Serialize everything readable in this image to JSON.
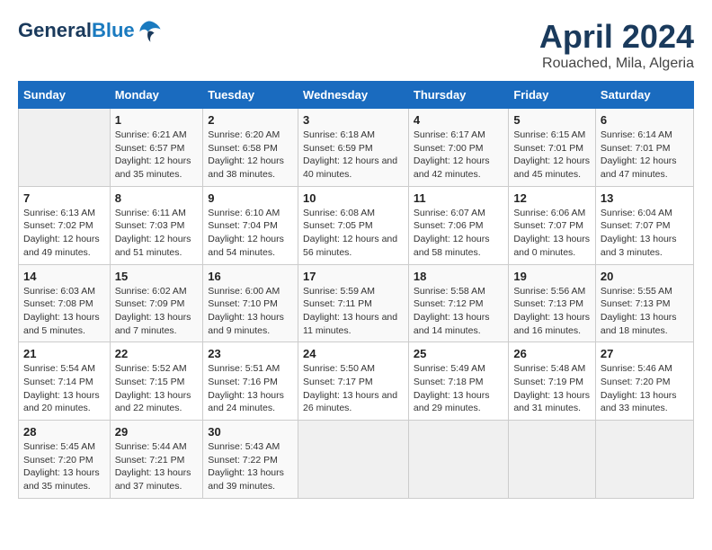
{
  "header": {
    "logo_line1": "General",
    "logo_line2": "Blue",
    "title": "April 2024",
    "subtitle": "Rouached, Mila, Algeria"
  },
  "calendar": {
    "days_of_week": [
      "Sunday",
      "Monday",
      "Tuesday",
      "Wednesday",
      "Thursday",
      "Friday",
      "Saturday"
    ],
    "weeks": [
      [
        {
          "day": "",
          "info": ""
        },
        {
          "day": "1",
          "info": "Sunrise: 6:21 AM\nSunset: 6:57 PM\nDaylight: 12 hours\nand 35 minutes."
        },
        {
          "day": "2",
          "info": "Sunrise: 6:20 AM\nSunset: 6:58 PM\nDaylight: 12 hours\nand 38 minutes."
        },
        {
          "day": "3",
          "info": "Sunrise: 6:18 AM\nSunset: 6:59 PM\nDaylight: 12 hours\nand 40 minutes."
        },
        {
          "day": "4",
          "info": "Sunrise: 6:17 AM\nSunset: 7:00 PM\nDaylight: 12 hours\nand 42 minutes."
        },
        {
          "day": "5",
          "info": "Sunrise: 6:15 AM\nSunset: 7:01 PM\nDaylight: 12 hours\nand 45 minutes."
        },
        {
          "day": "6",
          "info": "Sunrise: 6:14 AM\nSunset: 7:01 PM\nDaylight: 12 hours\nand 47 minutes."
        }
      ],
      [
        {
          "day": "7",
          "info": "Sunrise: 6:13 AM\nSunset: 7:02 PM\nDaylight: 12 hours\nand 49 minutes."
        },
        {
          "day": "8",
          "info": "Sunrise: 6:11 AM\nSunset: 7:03 PM\nDaylight: 12 hours\nand 51 minutes."
        },
        {
          "day": "9",
          "info": "Sunrise: 6:10 AM\nSunset: 7:04 PM\nDaylight: 12 hours\nand 54 minutes."
        },
        {
          "day": "10",
          "info": "Sunrise: 6:08 AM\nSunset: 7:05 PM\nDaylight: 12 hours\nand 56 minutes."
        },
        {
          "day": "11",
          "info": "Sunrise: 6:07 AM\nSunset: 7:06 PM\nDaylight: 12 hours\nand 58 minutes."
        },
        {
          "day": "12",
          "info": "Sunrise: 6:06 AM\nSunset: 7:07 PM\nDaylight: 13 hours\nand 0 minutes."
        },
        {
          "day": "13",
          "info": "Sunrise: 6:04 AM\nSunset: 7:07 PM\nDaylight: 13 hours\nand 3 minutes."
        }
      ],
      [
        {
          "day": "14",
          "info": "Sunrise: 6:03 AM\nSunset: 7:08 PM\nDaylight: 13 hours\nand 5 minutes."
        },
        {
          "day": "15",
          "info": "Sunrise: 6:02 AM\nSunset: 7:09 PM\nDaylight: 13 hours\nand 7 minutes."
        },
        {
          "day": "16",
          "info": "Sunrise: 6:00 AM\nSunset: 7:10 PM\nDaylight: 13 hours\nand 9 minutes."
        },
        {
          "day": "17",
          "info": "Sunrise: 5:59 AM\nSunset: 7:11 PM\nDaylight: 13 hours\nand 11 minutes."
        },
        {
          "day": "18",
          "info": "Sunrise: 5:58 AM\nSunset: 7:12 PM\nDaylight: 13 hours\nand 14 minutes."
        },
        {
          "day": "19",
          "info": "Sunrise: 5:56 AM\nSunset: 7:13 PM\nDaylight: 13 hours\nand 16 minutes."
        },
        {
          "day": "20",
          "info": "Sunrise: 5:55 AM\nSunset: 7:13 PM\nDaylight: 13 hours\nand 18 minutes."
        }
      ],
      [
        {
          "day": "21",
          "info": "Sunrise: 5:54 AM\nSunset: 7:14 PM\nDaylight: 13 hours\nand 20 minutes."
        },
        {
          "day": "22",
          "info": "Sunrise: 5:52 AM\nSunset: 7:15 PM\nDaylight: 13 hours\nand 22 minutes."
        },
        {
          "day": "23",
          "info": "Sunrise: 5:51 AM\nSunset: 7:16 PM\nDaylight: 13 hours\nand 24 minutes."
        },
        {
          "day": "24",
          "info": "Sunrise: 5:50 AM\nSunset: 7:17 PM\nDaylight: 13 hours\nand 26 minutes."
        },
        {
          "day": "25",
          "info": "Sunrise: 5:49 AM\nSunset: 7:18 PM\nDaylight: 13 hours\nand 29 minutes."
        },
        {
          "day": "26",
          "info": "Sunrise: 5:48 AM\nSunset: 7:19 PM\nDaylight: 13 hours\nand 31 minutes."
        },
        {
          "day": "27",
          "info": "Sunrise: 5:46 AM\nSunset: 7:20 PM\nDaylight: 13 hours\nand 33 minutes."
        }
      ],
      [
        {
          "day": "28",
          "info": "Sunrise: 5:45 AM\nSunset: 7:20 PM\nDaylight: 13 hours\nand 35 minutes."
        },
        {
          "day": "29",
          "info": "Sunrise: 5:44 AM\nSunset: 7:21 PM\nDaylight: 13 hours\nand 37 minutes."
        },
        {
          "day": "30",
          "info": "Sunrise: 5:43 AM\nSunset: 7:22 PM\nDaylight: 13 hours\nand 39 minutes."
        },
        {
          "day": "",
          "info": ""
        },
        {
          "day": "",
          "info": ""
        },
        {
          "day": "",
          "info": ""
        },
        {
          "day": "",
          "info": ""
        }
      ]
    ]
  }
}
